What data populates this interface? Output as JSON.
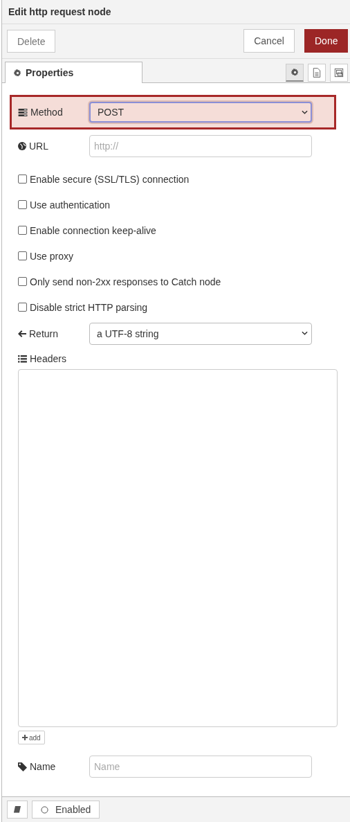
{
  "window": {
    "title": "Edit http request node"
  },
  "buttons": [
    {
      "label": "Delete",
      "kind": "plain"
    },
    {
      "label": "Cancel",
      "kind": "plain"
    },
    {
      "label": "Done",
      "kind": "primary"
    }
  ],
  "tabs": [
    {
      "label": "Properties",
      "selected": true
    }
  ],
  "side_tabs": [
    {
      "selected": true
    },
    {
      "selected": false
    },
    {
      "selected": false
    }
  ],
  "fields": [
    {
      "kind": "select",
      "label": "Method",
      "value": "POST",
      "highlighted": true
    },
    {
      "kind": "input",
      "label": "URL",
      "placeholder": "http://"
    },
    {
      "kind": "checkbox",
      "label": "Enable secure (SSL/TLS) connection",
      "checked": false
    },
    {
      "kind": "checkbox",
      "label": "Use authentication",
      "checked": false
    },
    {
      "kind": "checkbox",
      "label": "Enable connection keep-alive",
      "checked": false
    },
    {
      "kind": "checkbox",
      "label": "Use proxy",
      "checked": false
    },
    {
      "kind": "checkbox",
      "label": "Only send non-2xx responses to Catch node",
      "checked": false
    },
    {
      "kind": "checkbox",
      "label": "Disable strict HTTP parsing",
      "checked": false
    },
    {
      "kind": "select",
      "label": "Return",
      "value": "a UTF-8 string"
    },
    {
      "kind": "list",
      "label": "Headers",
      "add_label": "add"
    },
    {
      "kind": "input",
      "label": "Name",
      "placeholder": "Name"
    }
  ],
  "footer": {
    "enabled_label": "Enabled",
    "enabled": true
  }
}
